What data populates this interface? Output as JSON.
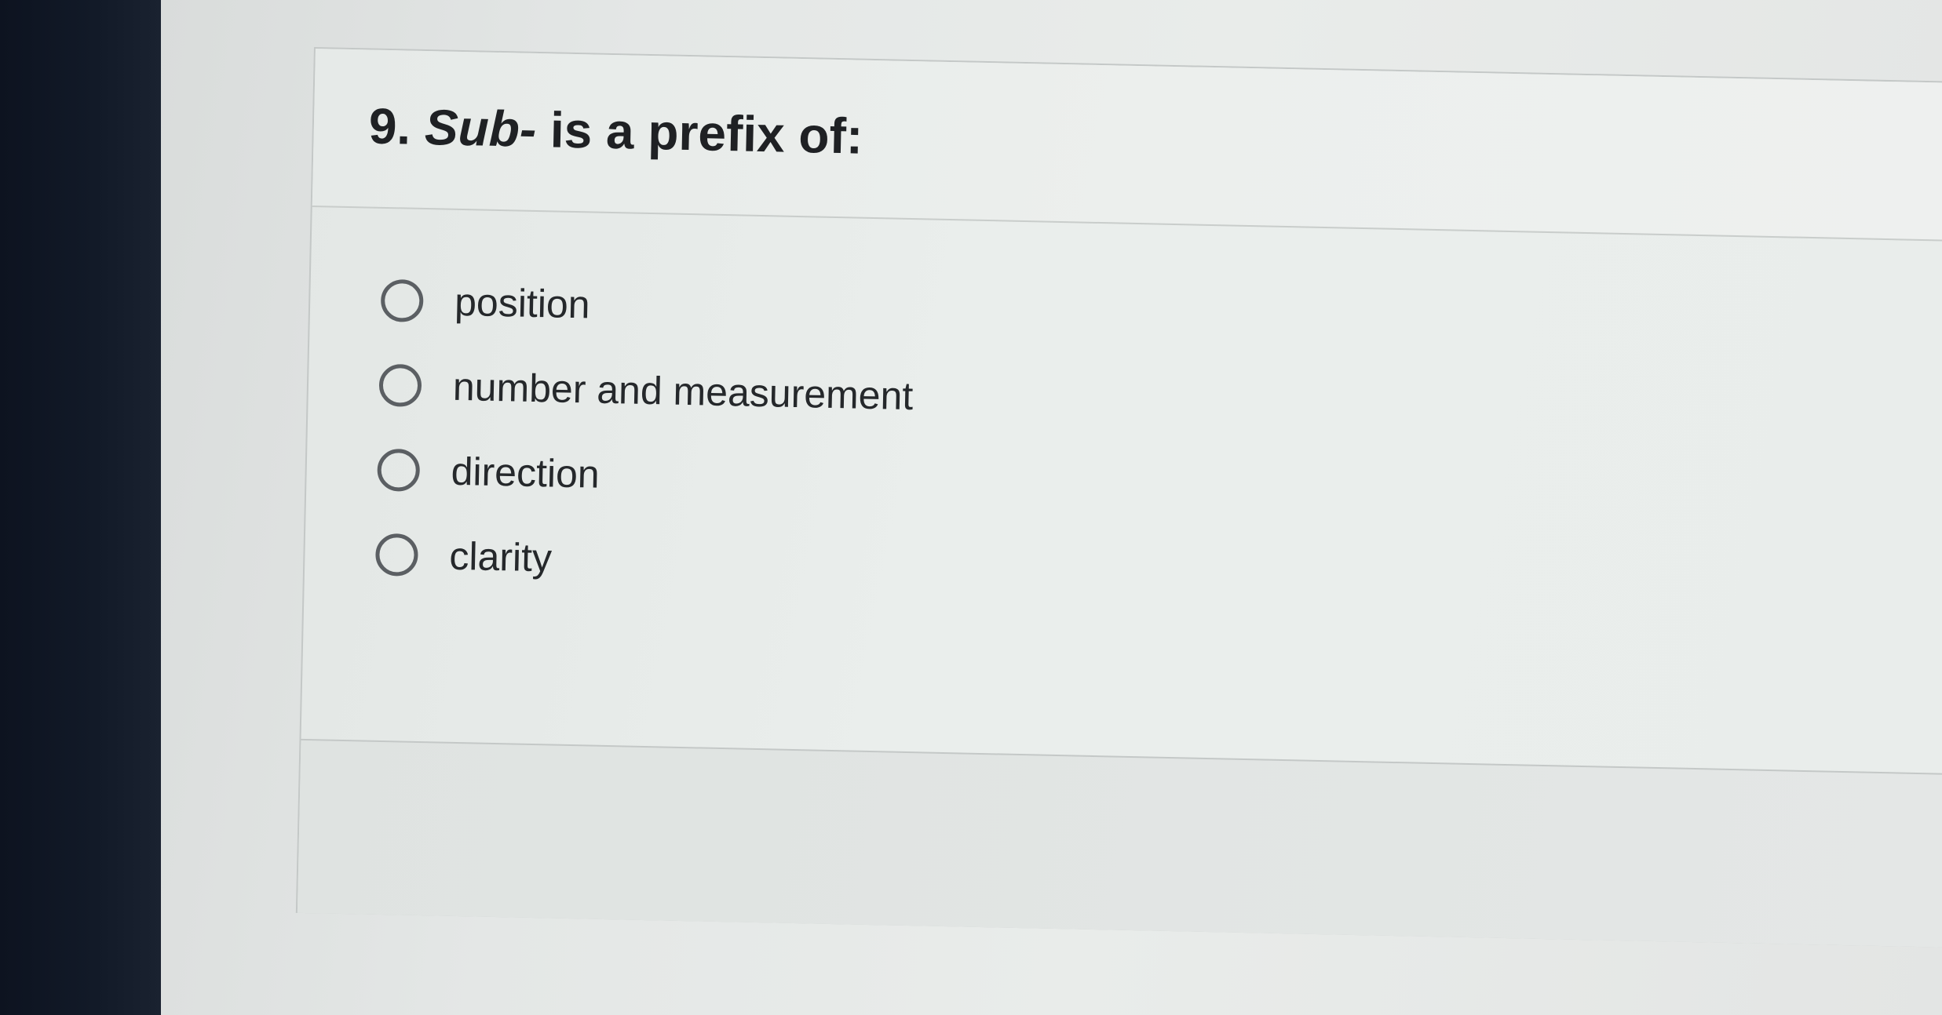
{
  "question": {
    "number": "9.",
    "term": "Sub-",
    "text": "is a prefix of:"
  },
  "options": [
    {
      "label": "position"
    },
    {
      "label": "number and measurement"
    },
    {
      "label": "direction"
    },
    {
      "label": "clarity"
    }
  ]
}
